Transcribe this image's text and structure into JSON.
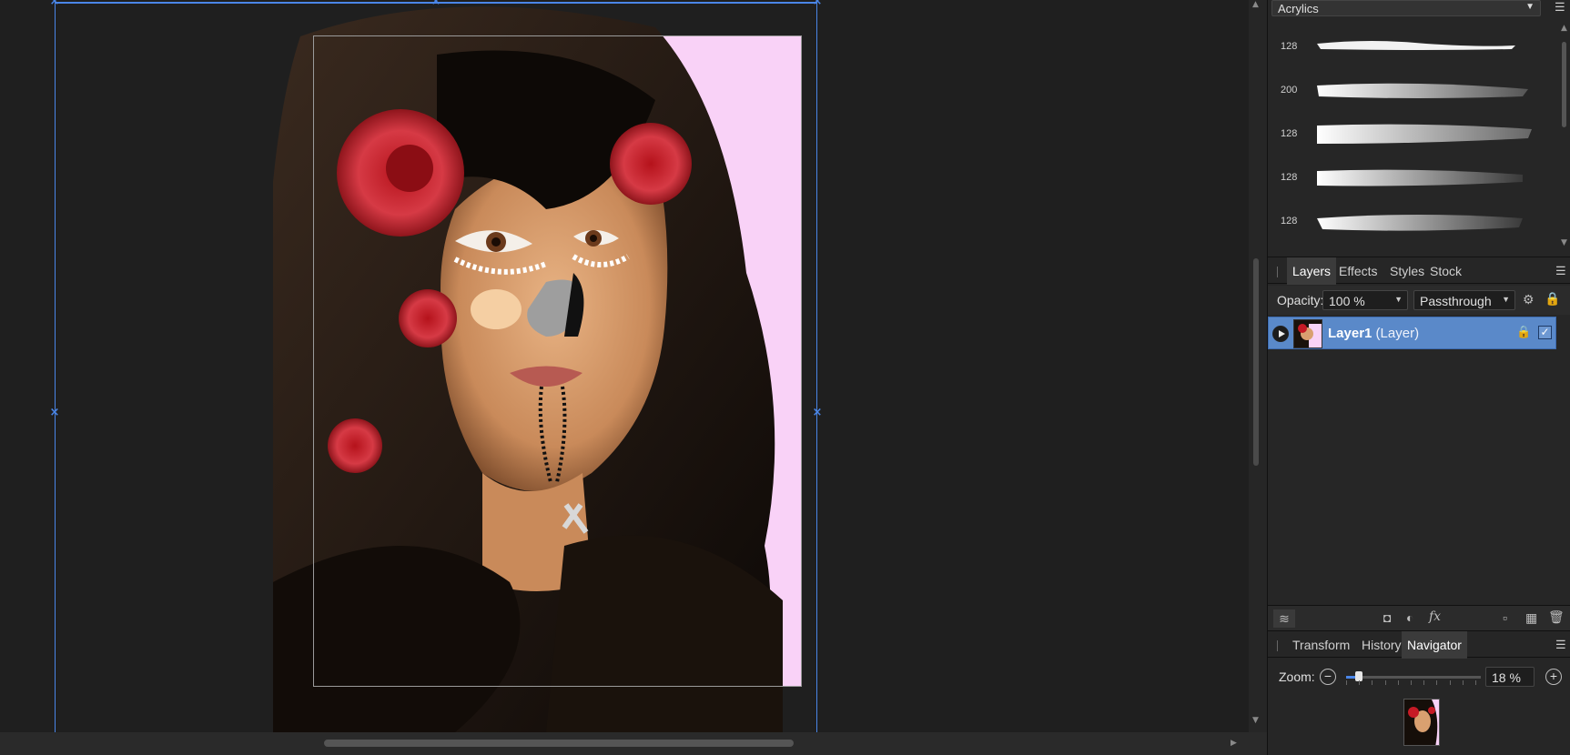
{
  "brushes": {
    "category": "Acrylics",
    "items": [
      {
        "size": "128"
      },
      {
        "size": "200"
      },
      {
        "size": "128"
      },
      {
        "size": "128"
      },
      {
        "size": "128"
      }
    ]
  },
  "layers_panel": {
    "tabs": [
      "Layers",
      "Effects",
      "Styles",
      "Stock"
    ],
    "active_tab": "Layers",
    "opacity_label": "Opacity:",
    "opacity_value": "100 %",
    "blend_mode": "Passthrough",
    "layer": {
      "name": "Layer1",
      "type": "(Layer)",
      "visible": true
    }
  },
  "bottom_panel": {
    "tabs": [
      "Transform",
      "History",
      "Navigator"
    ],
    "active_tab": "Navigator",
    "zoom_label": "Zoom:",
    "zoom_value": "18 %"
  },
  "colors": {
    "selection": "#4a86e8",
    "layer_highlight": "#5a89c9",
    "canvas_bg": "#1f1f1f",
    "panel_bg": "#262626"
  }
}
